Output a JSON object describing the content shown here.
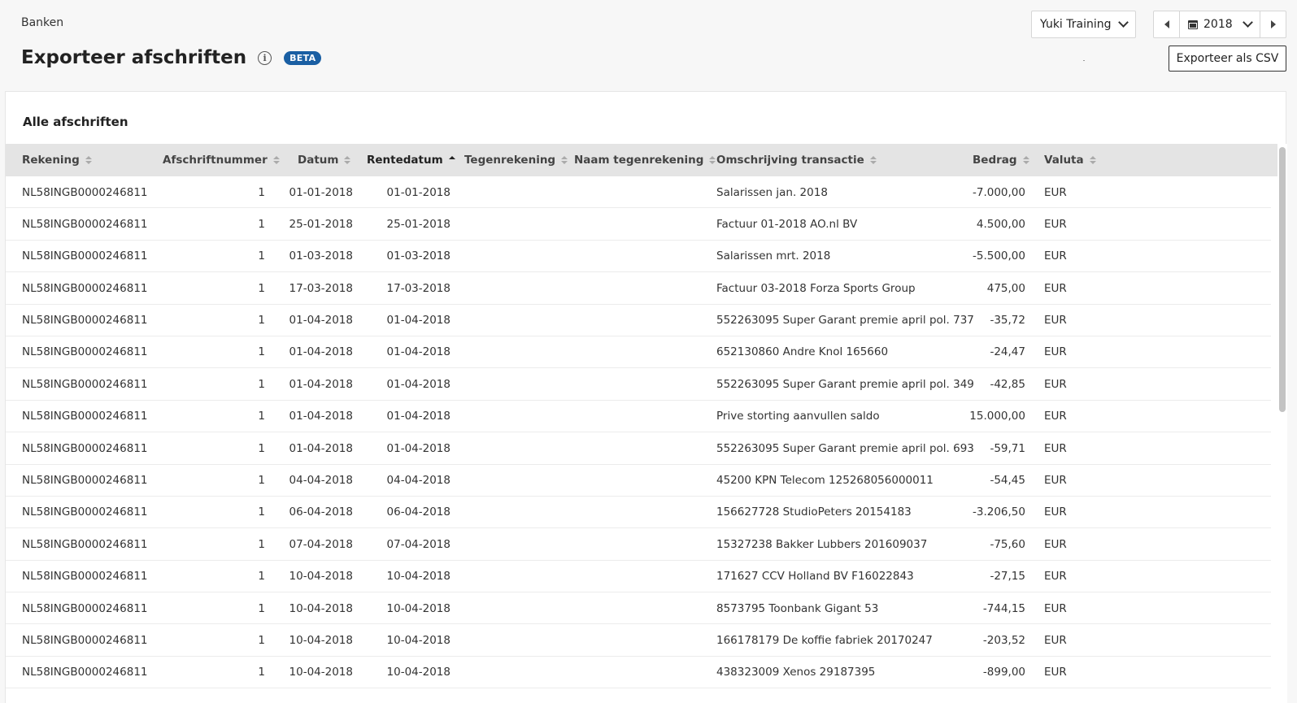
{
  "header": {
    "breadcrumb": "Banken",
    "title": "Exporteer afschriften",
    "beta": "BETA",
    "company": "Yuki Training",
    "year": "2018",
    "export_label": "Exporteer als CSV"
  },
  "card": {
    "title": "Alle afschriften"
  },
  "table": {
    "columns": {
      "rekening": "Rekening",
      "afschriftnummer": "Afschriftnummer",
      "datum": "Datum",
      "rentedatum": "Rentedatum",
      "tegenrekening": "Tegenrekening",
      "naam_tegenrekening": "Naam tegenrekening",
      "omschrijving": "Omschrijving transactie",
      "bedrag": "Bedrag",
      "valuta": "Valuta"
    },
    "rows": [
      {
        "rekening": "NL58INGB0000246811",
        "nr": "1",
        "datum": "01-01-2018",
        "rentedatum": "01-01-2018",
        "tegen": "",
        "naam": "",
        "omschrijving": "Salarissen jan. 2018",
        "bedrag": "-7.000,00",
        "valuta": "EUR"
      },
      {
        "rekening": "NL58INGB0000246811",
        "nr": "1",
        "datum": "25-01-2018",
        "rentedatum": "25-01-2018",
        "tegen": "",
        "naam": "",
        "omschrijving": "Factuur 01-2018 AO.nl BV",
        "bedrag": "4.500,00",
        "valuta": "EUR"
      },
      {
        "rekening": "NL58INGB0000246811",
        "nr": "1",
        "datum": "01-03-2018",
        "rentedatum": "01-03-2018",
        "tegen": "",
        "naam": "",
        "omschrijving": "Salarissen mrt. 2018",
        "bedrag": "-5.500,00",
        "valuta": "EUR"
      },
      {
        "rekening": "NL58INGB0000246811",
        "nr": "1",
        "datum": "17-03-2018",
        "rentedatum": "17-03-2018",
        "tegen": "",
        "naam": "",
        "omschrijving": "Factuur 03-2018 Forza Sports Group",
        "bedrag": "475,00",
        "valuta": "EUR"
      },
      {
        "rekening": "NL58INGB0000246811",
        "nr": "1",
        "datum": "01-04-2018",
        "rentedatum": "01-04-2018",
        "tegen": "",
        "naam": "",
        "omschrijving": "552263095 Super Garant premie april pol. 737",
        "bedrag": "-35,72",
        "valuta": "EUR"
      },
      {
        "rekening": "NL58INGB0000246811",
        "nr": "1",
        "datum": "01-04-2018",
        "rentedatum": "01-04-2018",
        "tegen": "",
        "naam": "",
        "omschrijving": "652130860 Andre Knol 165660",
        "bedrag": "-24,47",
        "valuta": "EUR"
      },
      {
        "rekening": "NL58INGB0000246811",
        "nr": "1",
        "datum": "01-04-2018",
        "rentedatum": "01-04-2018",
        "tegen": "",
        "naam": "",
        "omschrijving": "552263095 Super Garant premie april pol. 349",
        "bedrag": "-42,85",
        "valuta": "EUR"
      },
      {
        "rekening": "NL58INGB0000246811",
        "nr": "1",
        "datum": "01-04-2018",
        "rentedatum": "01-04-2018",
        "tegen": "",
        "naam": "",
        "omschrijving": "Prive storting aanvullen saldo",
        "bedrag": "15.000,00",
        "valuta": "EUR"
      },
      {
        "rekening": "NL58INGB0000246811",
        "nr": "1",
        "datum": "01-04-2018",
        "rentedatum": "01-04-2018",
        "tegen": "",
        "naam": "",
        "omschrijving": "552263095 Super Garant premie april pol. 693",
        "bedrag": "-59,71",
        "valuta": "EUR"
      },
      {
        "rekening": "NL58INGB0000246811",
        "nr": "1",
        "datum": "04-04-2018",
        "rentedatum": "04-04-2018",
        "tegen": "",
        "naam": "",
        "omschrijving": "45200 KPN Telecom 125268056000011",
        "bedrag": "-54,45",
        "valuta": "EUR"
      },
      {
        "rekening": "NL58INGB0000246811",
        "nr": "1",
        "datum": "06-04-2018",
        "rentedatum": "06-04-2018",
        "tegen": "",
        "naam": "",
        "omschrijving": "156627728 StudioPeters 20154183",
        "bedrag": "-3.206,50",
        "valuta": "EUR"
      },
      {
        "rekening": "NL58INGB0000246811",
        "nr": "1",
        "datum": "07-04-2018",
        "rentedatum": "07-04-2018",
        "tegen": "",
        "naam": "",
        "omschrijving": "15327238 Bakker Lubbers 201609037",
        "bedrag": "-75,60",
        "valuta": "EUR"
      },
      {
        "rekening": "NL58INGB0000246811",
        "nr": "1",
        "datum": "10-04-2018",
        "rentedatum": "10-04-2018",
        "tegen": "",
        "naam": "",
        "omschrijving": "171627 CCV Holland BV F16022843",
        "bedrag": "-27,15",
        "valuta": "EUR"
      },
      {
        "rekening": "NL58INGB0000246811",
        "nr": "1",
        "datum": "10-04-2018",
        "rentedatum": "10-04-2018",
        "tegen": "",
        "naam": "",
        "omschrijving": "8573795 Toonbank Gigant 53",
        "bedrag": "-744,15",
        "valuta": "EUR"
      },
      {
        "rekening": "NL58INGB0000246811",
        "nr": "1",
        "datum": "10-04-2018",
        "rentedatum": "10-04-2018",
        "tegen": "",
        "naam": "",
        "omschrijving": "166178179 De koffie fabriek 20170247",
        "bedrag": "-203,52",
        "valuta": "EUR"
      },
      {
        "rekening": "NL58INGB0000246811",
        "nr": "1",
        "datum": "10-04-2018",
        "rentedatum": "10-04-2018",
        "tegen": "",
        "naam": "",
        "omschrijving": "438323009 Xenos 29187395",
        "bedrag": "-899,00",
        "valuta": "EUR"
      }
    ]
  }
}
